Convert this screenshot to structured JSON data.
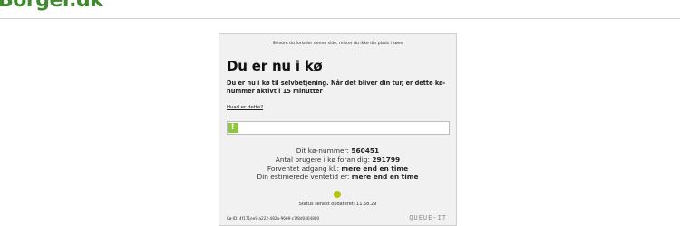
{
  "header": {
    "logo_text": "Borger.dk"
  },
  "card": {
    "notice": "Selvom du forlader denne side, mister du ikke din plads i køen",
    "title": "Du er nu i kø",
    "description": "Du er nu i kø til selvbetjening. Når det bliver din tur, er dette kø-nummer aktivt i 15 minutter",
    "what_link": "Hvad er dette?",
    "progress": {
      "fraction": 0.02,
      "glyph": "!"
    },
    "queue_number_label": "Dit kø-nummer: ",
    "queue_number": "560451",
    "users_ahead_label": "Antal brugere i kø foran dig: ",
    "users_ahead": "291799",
    "expected_label": "Forventet adgang kl.: ",
    "expected_value": "mere end en time",
    "estimated_label": "Din estimerede ventetid er: ",
    "estimated_value": "mere end en time",
    "status_text": "Status senest opdateret: 11.58.29",
    "queue_id_label": "Kø-ID: ",
    "queue_id": "4f171ee9-a222-482a-9669-c7f8d0464880",
    "brand": "QUEUE-IT"
  },
  "colors": {
    "logo_green": "#3f8a2f",
    "progress_green": "#8ec63f",
    "status_dot": "#b6c40d"
  }
}
